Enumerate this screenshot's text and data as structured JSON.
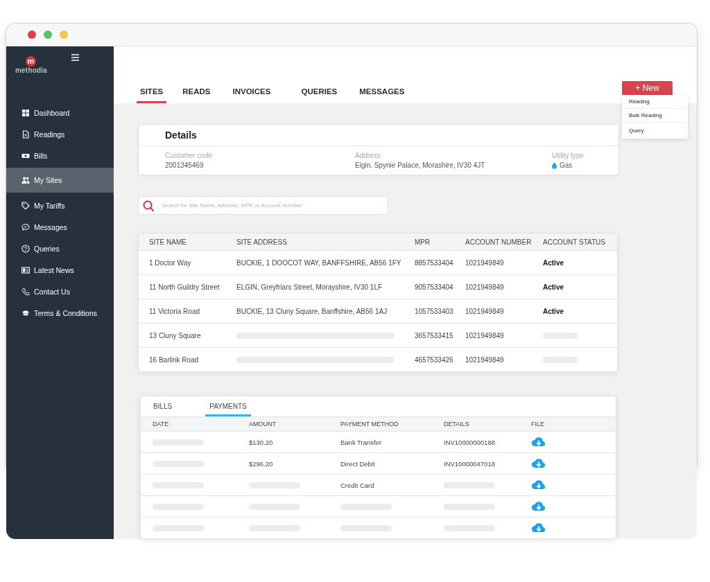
{
  "logo": {
    "mark": "m",
    "name": "methodia"
  },
  "sidebar": {
    "items": [
      {
        "label": "Dashboard",
        "selected": false
      },
      {
        "label": "Readings",
        "selected": false
      },
      {
        "label": "Bills",
        "selected": false
      },
      {
        "label": "My Sites",
        "selected": true
      },
      {
        "label": "My Tariffs",
        "selected": false
      },
      {
        "label": "Messages",
        "selected": false
      },
      {
        "label": "Queries",
        "selected": false
      },
      {
        "label": "Latest News",
        "selected": false
      },
      {
        "label": "Contact Us",
        "selected": false
      },
      {
        "label": "Terms & Conditions",
        "selected": false
      }
    ]
  },
  "tabs": [
    {
      "label": "SITES",
      "selected": true
    },
    {
      "label": "READS",
      "selected": false
    },
    {
      "label": "INVOICES",
      "selected": false
    },
    {
      "label": "QUERIES",
      "selected": false
    },
    {
      "label": "MESSAGES",
      "selected": false
    }
  ],
  "new_button": {
    "label": "+ New",
    "menu": [
      "Reading",
      "Bulk Reading",
      "Query"
    ]
  },
  "details": {
    "title": "Details",
    "fields": [
      {
        "label": "Customer code",
        "value": "2001345469"
      },
      {
        "label": "Address",
        "value": "Elgin. Spynie Palace, Morashire, IV30 4JT"
      },
      {
        "label": "Utility type",
        "value": "Gas"
      }
    ]
  },
  "search": {
    "placeholder": "Search for Site Name, Address, MPR or Account Number"
  },
  "sites_table": {
    "columns": [
      "SITE NAME",
      "SITE ADDRESS",
      "MPR",
      "ACCOUNT NUMBER",
      "ACCOUNT STATUS"
    ],
    "rows": [
      {
        "cells": [
          {
            "kind": "text",
            "text": "1 Doctor Way"
          },
          {
            "kind": "text",
            "text": "BUCKIE, 1 DOOCOT WAY, BANFFSHIRE, AB56 1FY"
          },
          {
            "kind": "text",
            "text": "8857533404"
          },
          {
            "kind": "text",
            "text": "1021949849"
          },
          {
            "kind": "text",
            "text": "Active"
          }
        ]
      },
      {
        "cells": [
          {
            "kind": "text",
            "text": "11 North Guildry Street"
          },
          {
            "kind": "text",
            "text": "ELGIN, Greyfriars Street, Morayshire, IV30 1LF"
          },
          {
            "kind": "text",
            "text": "9057533404"
          },
          {
            "kind": "text",
            "text": "1021949849"
          },
          {
            "kind": "text",
            "text": "Active"
          }
        ]
      },
      {
        "cells": [
          {
            "kind": "text",
            "text": "11 Victoria Road"
          },
          {
            "kind": "text",
            "text": "BUCKIE, 13 Cluny Square, Banffshire, AB56 1AJ"
          },
          {
            "kind": "text",
            "text": "1057533403"
          },
          {
            "kind": "text",
            "text": "1021949849"
          },
          {
            "kind": "text",
            "text": "Active"
          }
        ]
      },
      {
        "cells": [
          {
            "kind": "text",
            "text": "13 Cluny Square"
          },
          {
            "kind": "skeleton"
          },
          {
            "kind": "text",
            "text": "3657533415"
          },
          {
            "kind": "text",
            "text": "1021949849"
          },
          {
            "kind": "skeleton"
          }
        ]
      },
      {
        "cells": [
          {
            "kind": "text",
            "text": "16 Barlink Road"
          },
          {
            "kind": "skeleton"
          },
          {
            "kind": "text",
            "text": "4657533426"
          },
          {
            "kind": "text",
            "text": "1021949849"
          },
          {
            "kind": "skeleton"
          }
        ]
      }
    ]
  },
  "payments": {
    "tabs": [
      {
        "label": "BILLS",
        "selected": false
      },
      {
        "label": "PAYMENTS",
        "selected": true
      }
    ],
    "columns": [
      "DATE",
      "AMOUNT",
      "PAYMENT METHOD",
      "DETAILS",
      "FILE"
    ],
    "rows": [
      {
        "cells": [
          {
            "kind": "skeleton"
          },
          {
            "kind": "text",
            "text": "$130.20"
          },
          {
            "kind": "text",
            "text": "Bank Transfer"
          },
          {
            "kind": "text",
            "text": "INV10000000188"
          },
          {
            "kind": "download"
          }
        ]
      },
      {
        "cells": [
          {
            "kind": "skeleton"
          },
          {
            "kind": "text",
            "text": "$296.20"
          },
          {
            "kind": "text",
            "text": "Direct Debit"
          },
          {
            "kind": "text",
            "text": "INV10000047018"
          },
          {
            "kind": "download"
          }
        ]
      },
      {
        "cells": [
          {
            "kind": "skeleton"
          },
          {
            "kind": "skeleton"
          },
          {
            "kind": "text",
            "text": "Credit Card"
          },
          {
            "kind": "skeleton"
          },
          {
            "kind": "download"
          }
        ]
      },
      {
        "cells": [
          {
            "kind": "skeleton"
          },
          {
            "kind": "skeleton"
          },
          {
            "kind": "skeleton"
          },
          {
            "kind": "skeleton"
          },
          {
            "kind": "download"
          }
        ]
      },
      {
        "cells": [
          {
            "kind": "skeleton"
          },
          {
            "kind": "skeleton"
          },
          {
            "kind": "skeleton"
          },
          {
            "kind": "skeleton"
          },
          {
            "kind": "download"
          }
        ]
      }
    ]
  }
}
